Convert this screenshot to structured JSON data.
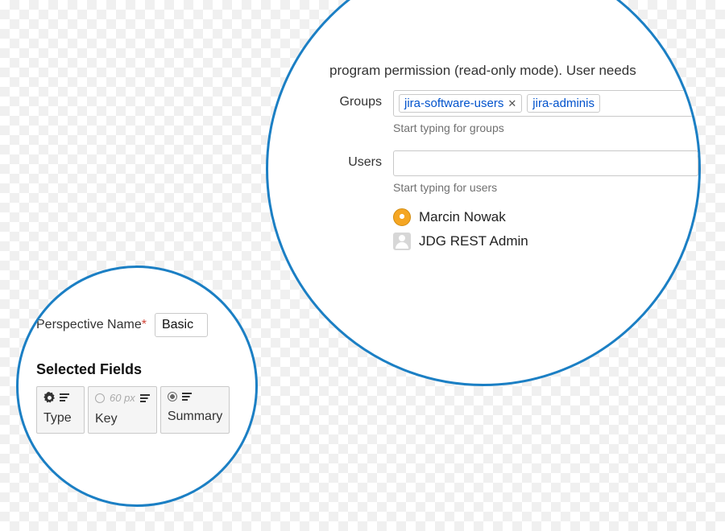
{
  "large_panel": {
    "headline": "program permission (read-only mode). User needs",
    "groups": {
      "label": "Groups",
      "tags": [
        {
          "text": "jira-software-users",
          "removable": true
        },
        {
          "text": "jira-adminis",
          "removable": false
        }
      ],
      "hint": "Start typing for groups"
    },
    "users": {
      "label": "Users",
      "value": "",
      "hint": "Start typing for users",
      "suggestions": [
        {
          "name": "Marcin Nowak",
          "avatar": "orange"
        },
        {
          "name": "JDG REST Admin",
          "avatar": "grey"
        }
      ]
    }
  },
  "small_panel": {
    "perspective": {
      "label": "Perspective Name",
      "required": true,
      "value": "Basic"
    },
    "selected_fields_heading": "Selected Fields",
    "fields": [
      {
        "label": "Type",
        "top_kind": "gear"
      },
      {
        "label": "Key",
        "top_kind": "radio-empty",
        "px_text": "60 px"
      },
      {
        "label": "Summary",
        "top_kind": "radio-filled"
      }
    ]
  }
}
